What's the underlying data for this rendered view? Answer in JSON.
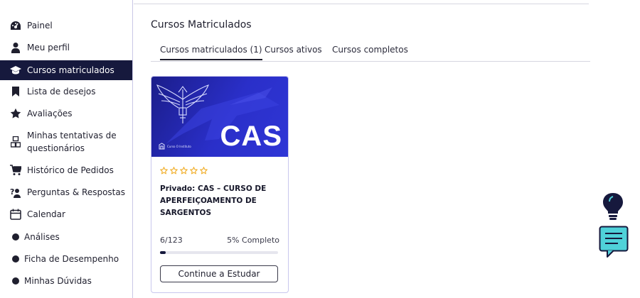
{
  "sidebar": {
    "items": [
      {
        "label": "Painel",
        "icon": "dashboard-icon"
      },
      {
        "label": "Meu perfil",
        "icon": "user-icon"
      },
      {
        "label": "Cursos matriculados",
        "icon": "graduation-cap-icon",
        "active": true
      },
      {
        "label": "Lista de desejos",
        "icon": "bookmark-icon"
      },
      {
        "label": "Avaliações",
        "icon": "star-icon"
      },
      {
        "label_line1": "Minhas tentativas de",
        "label_line2": "questionários",
        "icon": "quiz-attempts-icon"
      },
      {
        "label": "Histórico de Pedidos",
        "icon": "cart-icon"
      },
      {
        "label": "Perguntas & Respostas",
        "icon": "question-answer-icon"
      },
      {
        "label": "Calendar",
        "icon": "calendar-icon"
      },
      {
        "label": "Análises",
        "icon": "dot-icon"
      },
      {
        "label": "Ficha de Desempenho",
        "icon": "dot-icon"
      },
      {
        "label": "Minhas Dúvidas",
        "icon": "dot-icon"
      }
    ]
  },
  "main": {
    "title": "Cursos Matriculados",
    "tabs": [
      {
        "label": "Cursos matriculados (1)",
        "active": true
      },
      {
        "label": "Cursos ativos"
      },
      {
        "label": "Cursos completos"
      }
    ]
  },
  "course": {
    "banner_text": "CAS",
    "banner_brand": "Curso O Instituto",
    "rating": 0,
    "title": "Privado: CAS – CURSO DE APERFEIÇOAMENTO DE SARGENTOS",
    "progress_text": "6/123",
    "progress_percent": "5% Completo",
    "progress_fraction": 0.05,
    "button_label": "Continue a Estudar"
  },
  "floating": {
    "tip_icon": "lightbulb-icon",
    "notes_icon": "notes-icon"
  },
  "colors": {
    "active_bg": "#16193d",
    "banner_blue": "#2a2fc9",
    "star": "#f0a818",
    "fab_teal": "#4fd1d9"
  }
}
